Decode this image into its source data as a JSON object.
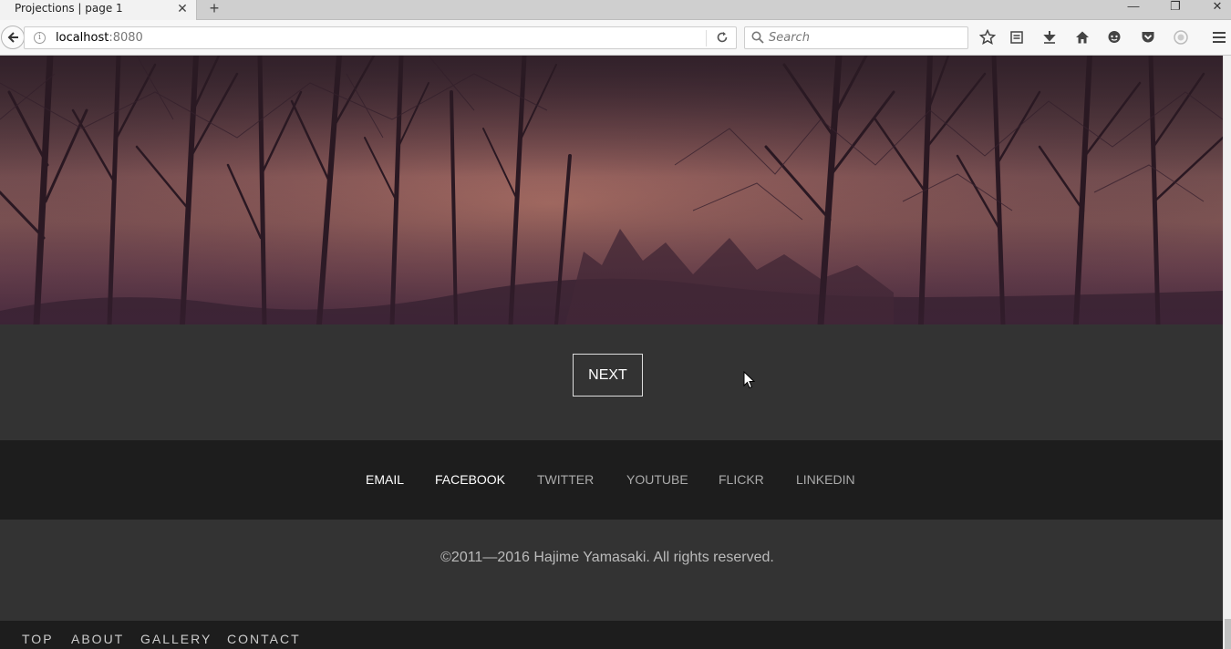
{
  "browser": {
    "tab_title": "Projections | page 1",
    "tab_close": "✕",
    "new_tab": "+",
    "window_controls": {
      "minimize": "—",
      "restore": "❐",
      "close": "✕"
    },
    "url_host": "localhost",
    "url_port": ":8080",
    "search_placeholder": "Search",
    "toolbar_icons": [
      "bookmark-star-icon",
      "reading-list-icon",
      "download-icon",
      "home-icon",
      "chat-icon",
      "pocket-icon",
      "account-icon",
      "menu-icon"
    ]
  },
  "hero": {
    "image": "sunset-trees-photo",
    "tint": "#7a4f55"
  },
  "pager": {
    "next_label": "NEXT"
  },
  "social": {
    "links": [
      {
        "label": "EMAIL",
        "active": true
      },
      {
        "label": "FACEBOOK",
        "active": true
      },
      {
        "label": "TWITTER",
        "active": false
      },
      {
        "label": "YOUTUBE",
        "active": false
      },
      {
        "label": "FLICKR",
        "active": false
      },
      {
        "label": "LINKEDIN",
        "active": false
      }
    ]
  },
  "footer": {
    "copyright": "©2011—2016 Hajime Yamasaki. All rights reserved."
  },
  "bottom_nav": {
    "items": [
      "TOP",
      "ABOUT",
      "GALLERY",
      "CONTACT"
    ]
  },
  "colors": {
    "section_bg": "#333333",
    "dark_bar_bg": "#1d1d1d",
    "active_link": "#ffffff",
    "inactive_link": "#aaaaaa"
  }
}
